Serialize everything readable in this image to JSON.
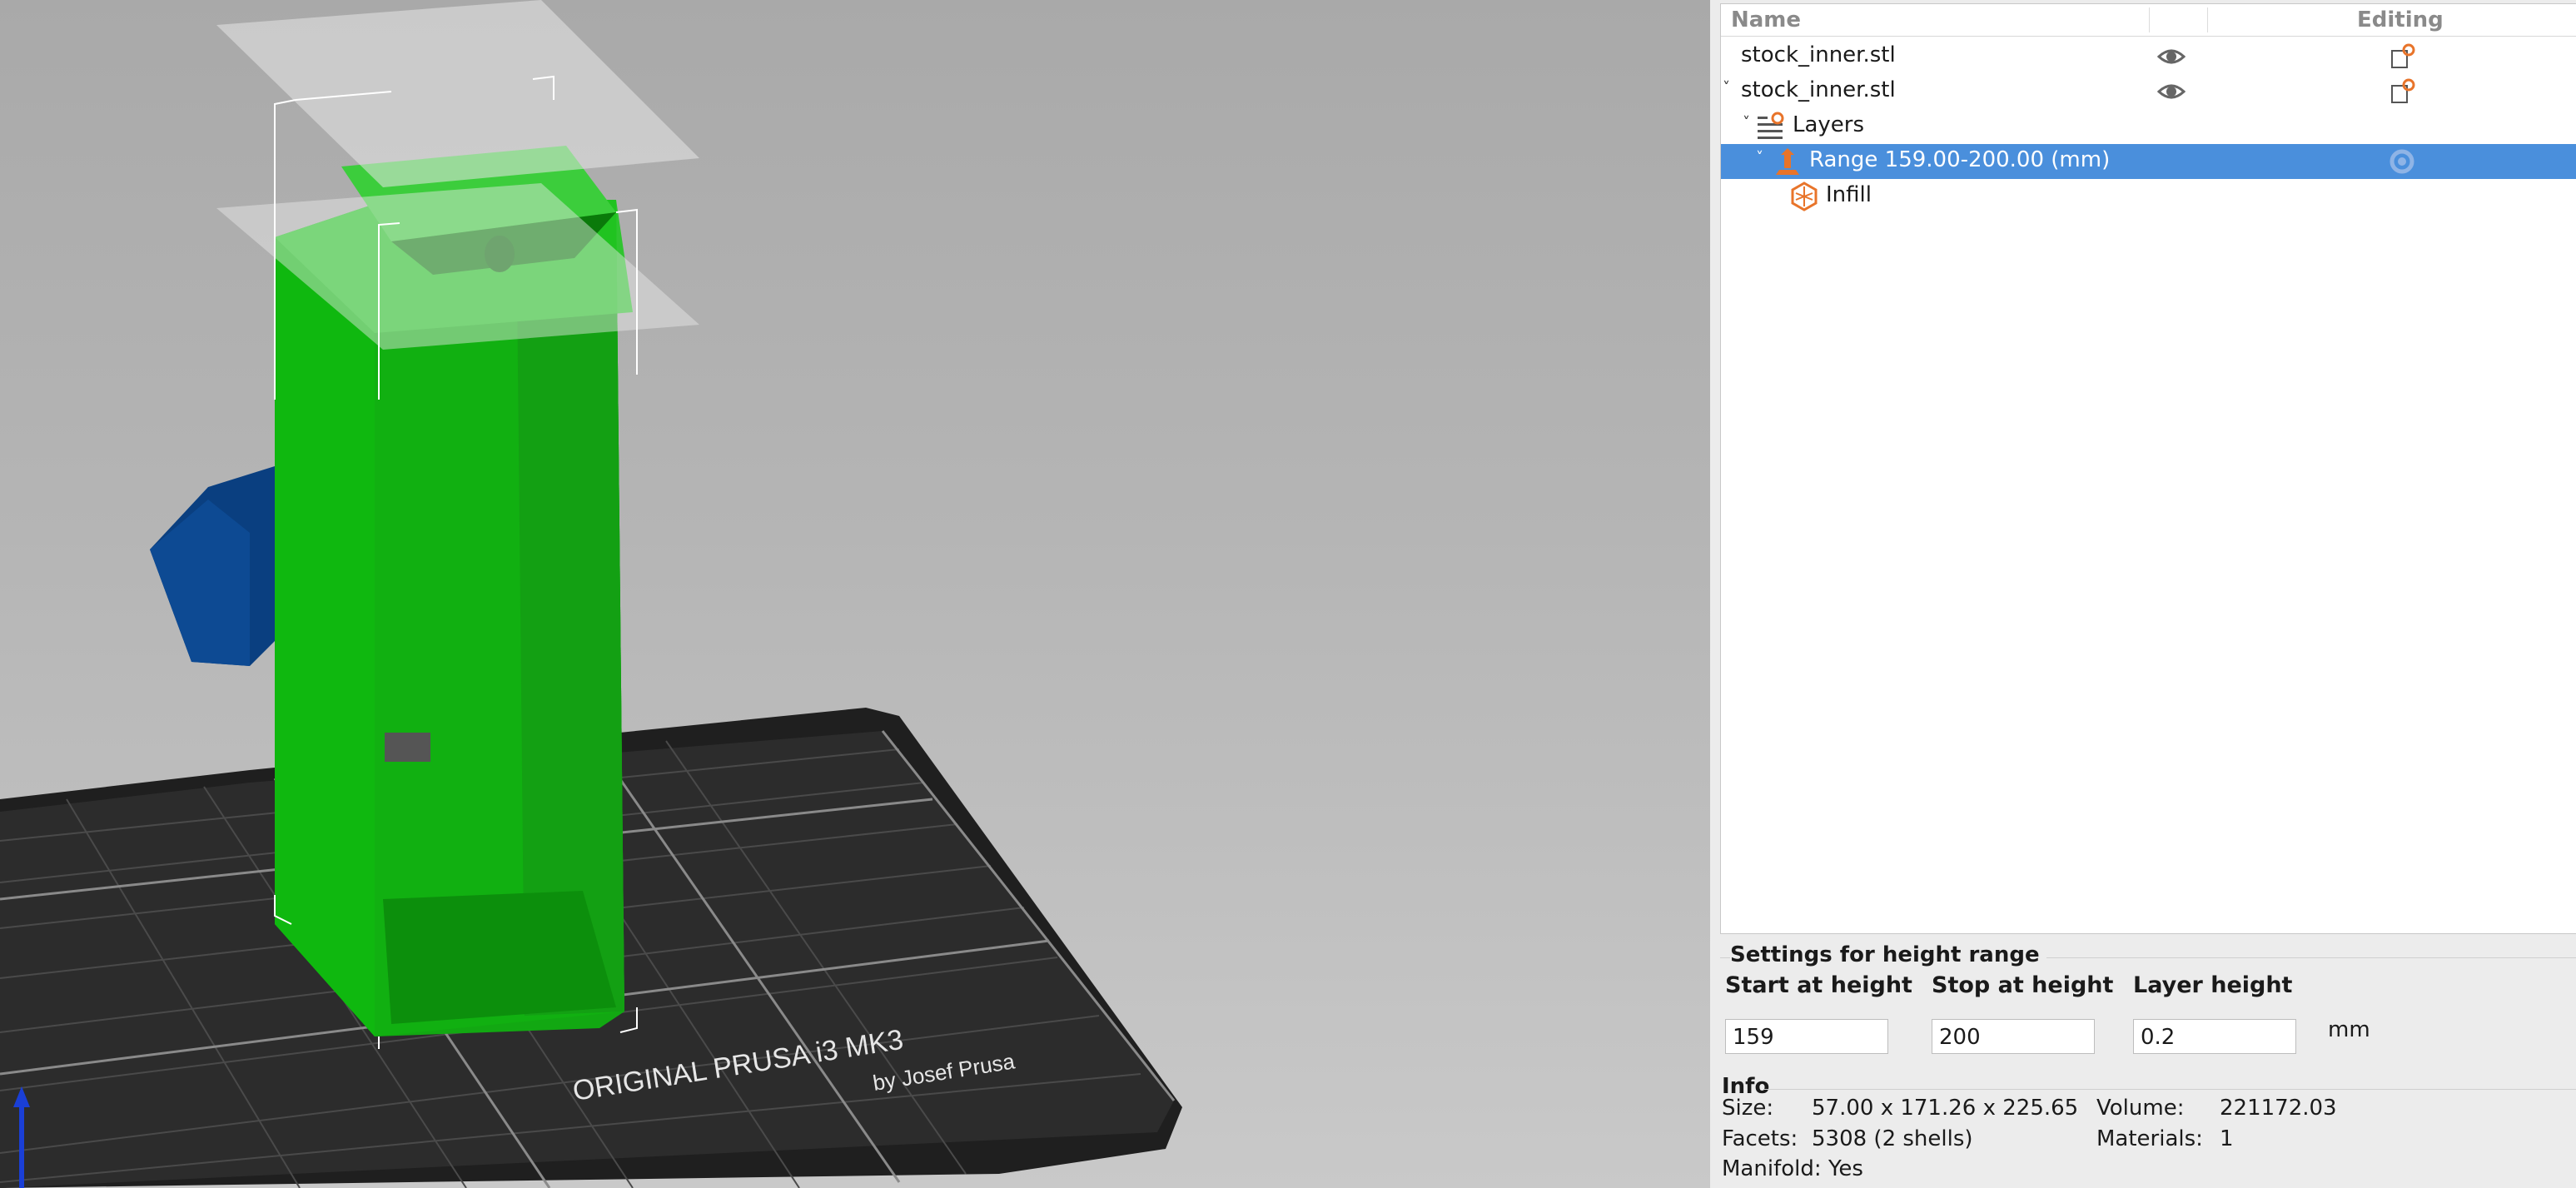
{
  "viewport": {
    "bed_brand_line1": "ORIGINAL PRUSA i3 MK3",
    "bed_brand_line2": "by Josef Prusa"
  },
  "object_list": {
    "columns": {
      "name": "Name",
      "editing": "Editing"
    },
    "items": [
      {
        "label": "stock_inner.stl",
        "type": "object",
        "visible_icon": "eye-icon",
        "edit_icon": "edit-object-icon"
      },
      {
        "label": "stock_inner.stl",
        "type": "object",
        "expanded": true,
        "visible_icon": "eye-icon",
        "edit_icon": "edit-object-icon"
      },
      {
        "label": "Layers",
        "type": "layers",
        "expanded": true,
        "icon": "layers-icon"
      },
      {
        "label": "Range 159.00-200.00 (mm)",
        "type": "range",
        "expanded": true,
        "selected": true,
        "icon": "range-icon",
        "edit_icon": "gear-icon"
      },
      {
        "label": "Infill",
        "type": "settings",
        "icon": "infill-icon"
      }
    ]
  },
  "height_range_settings": {
    "title": "Settings for height range",
    "start_label": "Start at height",
    "stop_label": "Stop at height",
    "layer_height_label": "Layer height",
    "start_value": "159",
    "stop_value": "200",
    "layer_height_value": "0.2",
    "unit": "mm"
  },
  "info": {
    "title": "Info",
    "size_label": "Size:",
    "size_value": "57.00 x 171.26 x 225.65",
    "volume_label": "Volume:",
    "volume_value": "221172.03",
    "facets_label": "Facets:",
    "facets_value": "5308 (2 shells)",
    "materials_label": "Materials:",
    "materials_value": "1",
    "manifold_label": "Manifold:",
    "manifold_value": "Yes"
  },
  "colors": {
    "selected_row": "#4a8fdc",
    "model_green": "#12b312",
    "model_blue": "#0a3f80",
    "bed": "#2f2f2f",
    "accent_orange": "#e8742a"
  }
}
